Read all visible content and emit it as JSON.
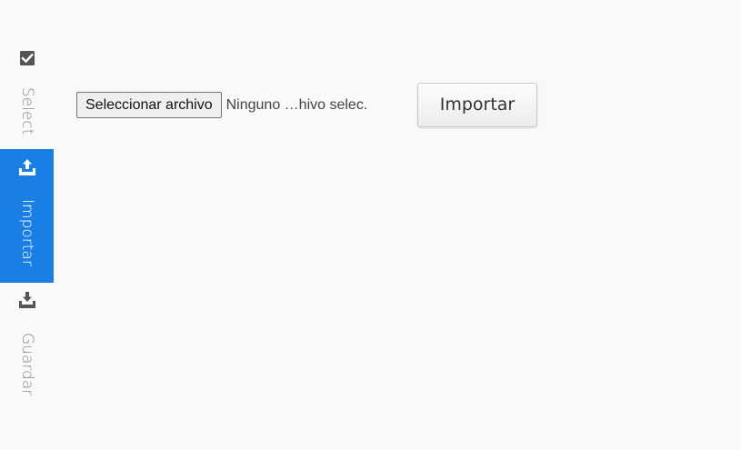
{
  "sidebar": {
    "items": [
      {
        "label": "Select",
        "icon": "checkbox-icon",
        "active": false
      },
      {
        "label": "Importar",
        "icon": "upload-icon",
        "active": true
      },
      {
        "label": "Guardar",
        "icon": "download-icon",
        "active": false
      }
    ]
  },
  "main": {
    "file_input": {
      "button_label": "Seleccionar archivo",
      "status_text": "Ninguno …hivo selec."
    },
    "import_button_label": "Importar"
  },
  "colors": {
    "active_tab": "#1a7fe4",
    "background": "#f9f9f9",
    "icon_inactive": "#555555",
    "label_inactive": "#8a8a8a"
  }
}
